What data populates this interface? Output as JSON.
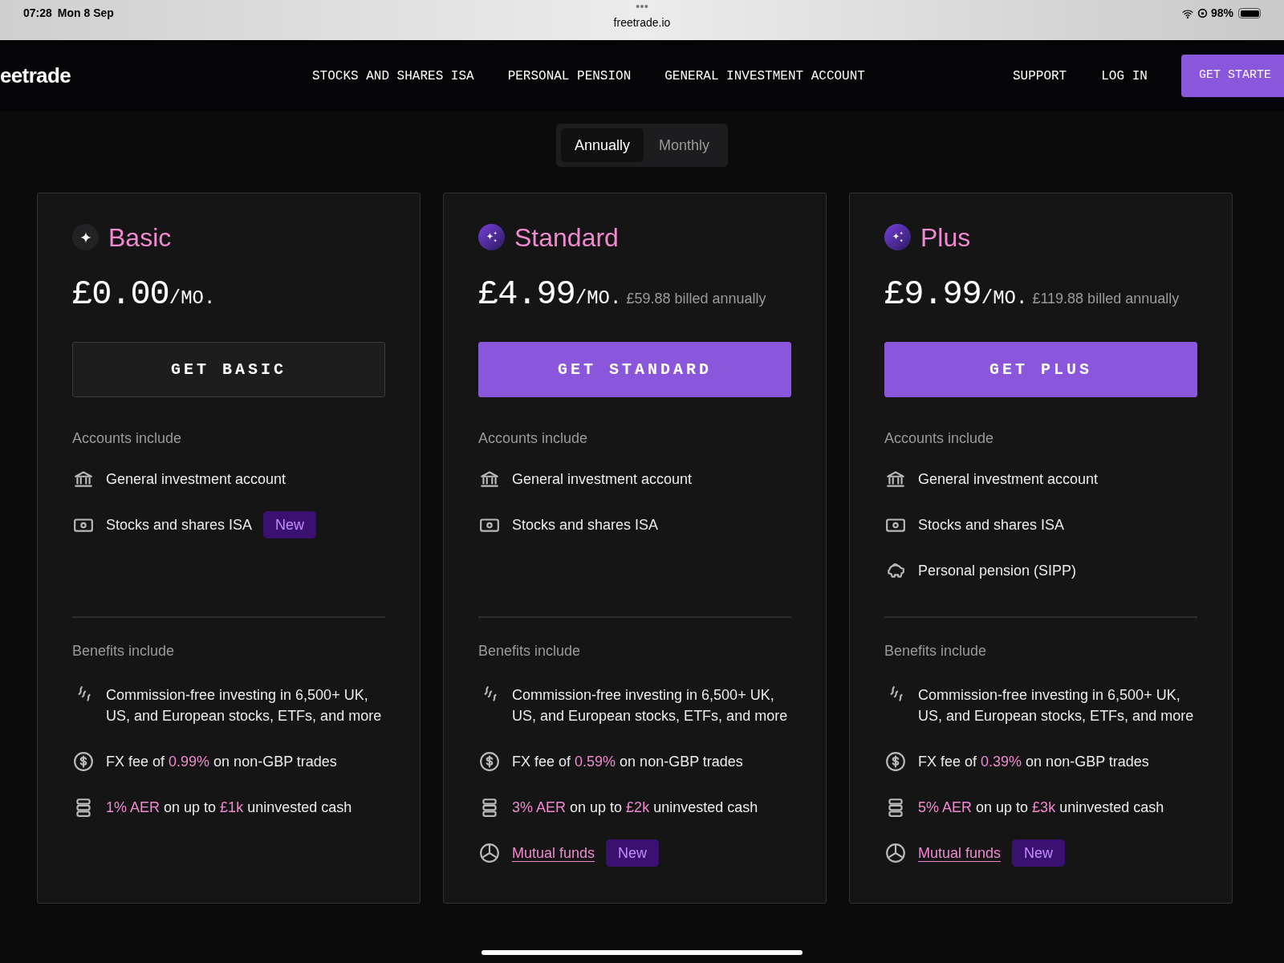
{
  "status_bar": {
    "time": "07:28",
    "date": "Mon 8 Sep",
    "url": "freetrade.io",
    "battery": "98%"
  },
  "nav": {
    "logo": "eetrade",
    "links": [
      "STOCKS AND SHARES ISA",
      "PERSONAL PENSION",
      "GENERAL INVESTMENT ACCOUNT"
    ],
    "right_links": [
      "SUPPORT",
      "LOG IN"
    ],
    "cta": "GET STARTE"
  },
  "billing_toggle": [
    {
      "label": "Annually",
      "selected": true
    },
    {
      "label": "Monthly",
      "selected": false
    }
  ],
  "plans": [
    {
      "name": "Basic",
      "kind": "single",
      "price": "£0.00",
      "per": "/MO.",
      "button": {
        "label": "GET BASIC",
        "primary": false
      },
      "accounts_heading": "Accounts include",
      "accounts": [
        {
          "kind": "bank",
          "text": "General investment account"
        },
        {
          "kind": "cash",
          "text": "Stocks and shares ISA",
          "badge": "New"
        }
      ],
      "benefits_heading": "Benefits include",
      "benefits": [
        {
          "kind": "flow",
          "text": "Commission-free investing in 6,500+ UK, US, and European stocks, ETFs, and more"
        },
        {
          "kind": "dollar",
          "text": "FX fee of **0.99%** on non-GBP trades"
        },
        {
          "kind": "stack",
          "text": "**1% AER** on up to **£1k** uninvested cash"
        }
      ]
    },
    {
      "name": "Standard",
      "kind": "multi",
      "price": "£4.99",
      "per": "/MO.",
      "billed": "£59.88 billed annually",
      "button": {
        "label": "GET STANDARD",
        "primary": true
      },
      "accounts_heading": "Accounts include",
      "accounts": [
        {
          "kind": "bank",
          "text": "General investment account"
        },
        {
          "kind": "cash",
          "text": "Stocks and shares ISA"
        }
      ],
      "benefits_heading": "Benefits include",
      "benefits": [
        {
          "kind": "flow",
          "text": "Commission-free investing in 6,500+ UK, US, and European stocks, ETFs, and more"
        },
        {
          "kind": "dollar",
          "text": "FX fee of **0.59%** on non-GBP trades"
        },
        {
          "kind": "stack",
          "text": "**3% AER** on up to **£2k** uninvested cash"
        },
        {
          "kind": "pie",
          "text": "Mutual funds",
          "link": true,
          "badge": "New"
        }
      ]
    },
    {
      "name": "Plus",
      "kind": "multi",
      "price": "£9.99",
      "per": "/MO.",
      "billed": "£119.88 billed annually",
      "button": {
        "label": "GET PLUS",
        "primary": true
      },
      "accounts_heading": "Accounts include",
      "accounts": [
        {
          "kind": "bank",
          "text": "General investment account"
        },
        {
          "kind": "cash",
          "text": "Stocks and shares ISA"
        },
        {
          "kind": "piggy",
          "text": "Personal pension (SIPP)"
        }
      ],
      "benefits_heading": "Benefits include",
      "benefits": [
        {
          "kind": "flow",
          "text": "Commission-free investing in 6,500+ UK, US, and European stocks, ETFs, and more"
        },
        {
          "kind": "dollar",
          "text": "FX fee of **0.39%** on non-GBP trades"
        },
        {
          "kind": "stack",
          "text": "**5% AER** on up to **£3k** uninvested cash"
        },
        {
          "kind": "pie",
          "text": "Mutual funds",
          "link": true,
          "badge": "New"
        }
      ]
    }
  ]
}
